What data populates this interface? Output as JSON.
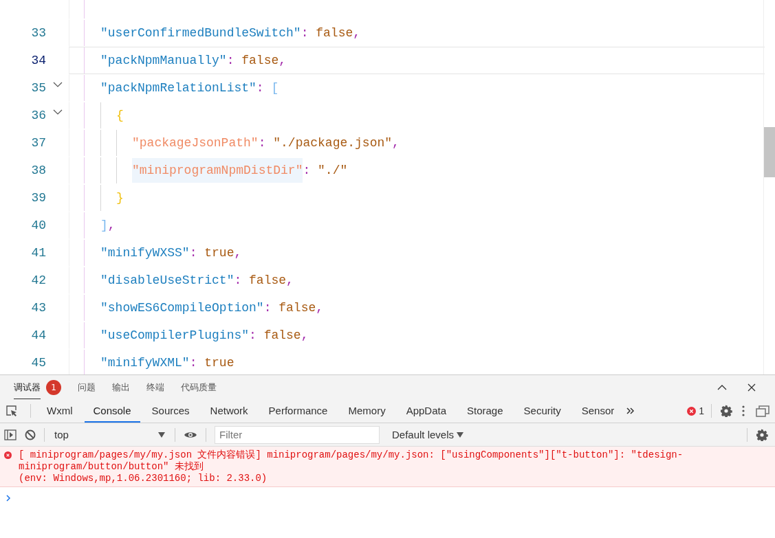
{
  "editor": {
    "lines": [
      {
        "number": "33",
        "current": false,
        "highlighted": false,
        "tokens": [
          {
            "kind": "key",
            "text": "\"userConfirmedBundleSwitch\""
          },
          {
            "kind": "punct",
            "text": ": "
          },
          {
            "kind": "literal",
            "text": "false"
          },
          {
            "kind": "punct",
            "text": ","
          }
        ]
      },
      {
        "number": "34",
        "current": true,
        "highlighted": false,
        "tokens": [
          {
            "kind": "key",
            "text": "\"packNpmManually\""
          },
          {
            "kind": "punct",
            "text": ": "
          },
          {
            "kind": "literal",
            "text": "false"
          },
          {
            "kind": "punct",
            "text": ","
          }
        ]
      },
      {
        "number": "35",
        "current": false,
        "highlighted": false,
        "expanded": true,
        "tokens": [
          {
            "kind": "key",
            "text": "\"packNpmRelationList\""
          },
          {
            "kind": "punct",
            "text": ": "
          },
          {
            "kind": "bracket",
            "text": "["
          }
        ],
        "children": [
          {
            "number": "36",
            "current": false,
            "highlighted": false,
            "expanded": true,
            "tokens": [
              {
                "kind": "brace",
                "text": "{"
              }
            ],
            "children": [
              {
                "number": "37",
                "current": false,
                "highlighted": false,
                "tokens": [
                  {
                    "kind": "nested-key",
                    "text": "\"packageJsonPath\""
                  },
                  {
                    "kind": "punct",
                    "text": ": "
                  },
                  {
                    "kind": "string",
                    "text": "\"./package.json\""
                  },
                  {
                    "kind": "punct",
                    "text": ","
                  }
                ]
              },
              {
                "number": "38",
                "current": false,
                "highlighted": true,
                "tokens": [
                  {
                    "kind": "nested-key",
                    "text": "\"miniprogramNpmDistDir\""
                  },
                  {
                    "kind": "punct",
                    "text": ": "
                  },
                  {
                    "kind": "string",
                    "text": "\"./\""
                  }
                ]
              }
            ]
          },
          {
            "number": "39",
            "current": false,
            "highlighted": false,
            "tokens": [
              {
                "kind": "brace",
                "text": "}"
              }
            ]
          }
        ]
      },
      {
        "number": "40",
        "current": false,
        "highlighted": false,
        "tokens": [
          {
            "kind": "bracket",
            "text": "]"
          },
          {
            "kind": "punct",
            "text": ","
          }
        ]
      },
      {
        "number": "41",
        "current": false,
        "highlighted": false,
        "tokens": [
          {
            "kind": "key",
            "text": "\"minifyWXSS\""
          },
          {
            "kind": "punct",
            "text": ": "
          },
          {
            "kind": "literal",
            "text": "true"
          },
          {
            "kind": "punct",
            "text": ","
          }
        ]
      },
      {
        "number": "42",
        "current": false,
        "highlighted": false,
        "tokens": [
          {
            "kind": "key",
            "text": "\"disableUseStrict\""
          },
          {
            "kind": "punct",
            "text": ": "
          },
          {
            "kind": "literal",
            "text": "false"
          },
          {
            "kind": "punct",
            "text": ","
          }
        ]
      },
      {
        "number": "43",
        "current": false,
        "highlighted": false,
        "tokens": [
          {
            "kind": "key",
            "text": "\"showES6CompileOption\""
          },
          {
            "kind": "punct",
            "text": ": "
          },
          {
            "kind": "literal",
            "text": "false"
          },
          {
            "kind": "punct",
            "text": ","
          }
        ]
      },
      {
        "number": "44",
        "current": false,
        "highlighted": false,
        "tokens": [
          {
            "kind": "key",
            "text": "\"useCompilerPlugins\""
          },
          {
            "kind": "punct",
            "text": ": "
          },
          {
            "kind": "literal",
            "text": "false"
          },
          {
            "kind": "punct",
            "text": ","
          }
        ]
      },
      {
        "number": "45",
        "current": false,
        "highlighted": false,
        "tokens": [
          {
            "kind": "key",
            "text": "\"minifyWXML\""
          },
          {
            "kind": "punct",
            "text": ": "
          },
          {
            "kind": "literal",
            "text": "true"
          }
        ]
      }
    ]
  },
  "devtools": {
    "panel_tabs": [
      {
        "label": "调试器",
        "selected": true,
        "badge": "1"
      },
      {
        "label": "问题",
        "selected": false
      },
      {
        "label": "输出",
        "selected": false
      },
      {
        "label": "终端",
        "selected": false
      },
      {
        "label": "代码质量",
        "selected": false
      }
    ],
    "tabs": [
      {
        "label": "Wxml",
        "selected": false
      },
      {
        "label": "Console",
        "selected": true
      },
      {
        "label": "Sources",
        "selected": false
      },
      {
        "label": "Network",
        "selected": false
      },
      {
        "label": "Performance",
        "selected": false
      },
      {
        "label": "Memory",
        "selected": false
      },
      {
        "label": "AppData",
        "selected": false
      },
      {
        "label": "Storage",
        "selected": false
      },
      {
        "label": "Security",
        "selected": false
      },
      {
        "label": "Sensor",
        "selected": false
      }
    ],
    "error_count": "1",
    "context": "top",
    "filter": {
      "placeholder": "Filter"
    },
    "levels": "Default levels",
    "messages": [
      {
        "kind": "error",
        "text": "[ miniprogram/pages/my/my.json 文件内容错误] miniprogram/pages/my/my.json: [\"usingComponents\"][\"t-button\"]: \"tdesign-miniprogram/button/button\" 未找到",
        "detail": "(env: Windows,mp,1.06.2301160; lib: 2.33.0)"
      }
    ]
  }
}
